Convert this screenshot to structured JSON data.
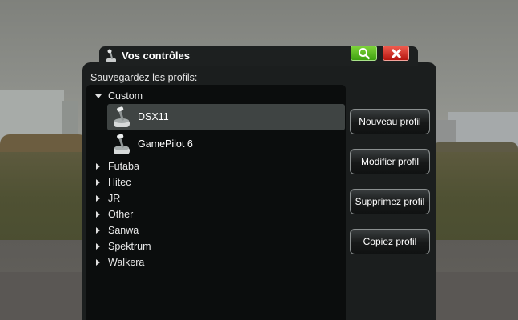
{
  "dialog": {
    "title": "Vos contrôles",
    "subtitle": "Sauvegardez les profils:",
    "colors": {
      "search_button": "#5cbf22",
      "close_button": "#d8342a",
      "selection": "#3f4443"
    }
  },
  "tree": {
    "expanded_group": "Custom",
    "profiles": [
      {
        "label": "DSX11",
        "selected": true,
        "icon": "transmitter-icon"
      },
      {
        "label": "GamePilot 6",
        "selected": false,
        "icon": "transmitter-icon"
      }
    ],
    "groups": [
      "Futaba",
      "Hitec",
      "JR",
      "Other",
      "Sanwa",
      "Spektrum",
      "Walkera"
    ]
  },
  "buttons": {
    "new": "Nouveau profil",
    "edit": "Modifier profil",
    "delete": "Supprimez profil",
    "copy": "Copiez profil"
  }
}
